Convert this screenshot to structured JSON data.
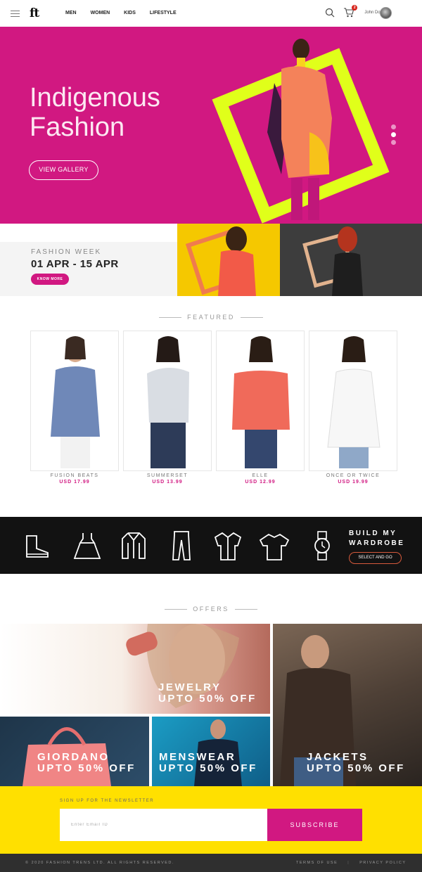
{
  "header": {
    "logo": "ft",
    "nav": [
      "MEN",
      "WOMEN",
      "KIDS",
      "LIFESTYLE"
    ],
    "cart_count": "2",
    "user_name": "John Doe"
  },
  "hero": {
    "title_line1": "Indigenous",
    "title_line2": "Fashion",
    "button": "VIEW GALLERY",
    "slide_count": 3,
    "active_slide": 2
  },
  "fashion_week": {
    "label": "FASHION WEEK",
    "dates": "01 APR - 15 APR",
    "button": "KNOW MORE"
  },
  "featured": {
    "title": "FEATURED",
    "products": [
      {
        "name": "FUSION BEATS",
        "price": "USD 17.99"
      },
      {
        "name": "SUMMERSET",
        "price": "USD 13.99"
      },
      {
        "name": "ELLE",
        "price": "USD 12.99"
      },
      {
        "name": "ONCE OR TWICE",
        "price": "USD 19.99"
      }
    ]
  },
  "wardrobe": {
    "title_line1": "BUILD MY",
    "title_line2": "WARDROBE",
    "button": "SELECT AND GO",
    "icons": [
      "boot-icon",
      "dress-icon",
      "jacket-icon",
      "trousers-icon",
      "shirt-icon",
      "tshirt-icon",
      "watch-icon"
    ]
  },
  "offers": {
    "title": "OFFERS",
    "items": [
      {
        "title": "JEWELRY",
        "subtitle": "UPTO 50% OFF"
      },
      {
        "title": "GIORDANO",
        "subtitle": "UPTO 50% OFF"
      },
      {
        "title": "MENSWEAR",
        "subtitle": "UPTO 50% OFF"
      },
      {
        "title": "JACKETS",
        "subtitle": "UPTO 50% OFF"
      }
    ]
  },
  "newsletter": {
    "label": "SIGN UP FOR THE NEWSLETTER",
    "placeholder": "Enter Email ID",
    "button": "SUBSCRIBE"
  },
  "footer": {
    "copyright": "© 2020 FASHION TRENS LTD. ALL RIGHTS RESERVED.",
    "terms": "TERMS OF USE",
    "separator": "|",
    "privacy": "PRIVACY POLICY"
  },
  "colors": {
    "brand_pink": "#d11881",
    "hero_lime": "#e0ff1a",
    "yellow": "#ffe000",
    "dark": "#121212"
  }
}
